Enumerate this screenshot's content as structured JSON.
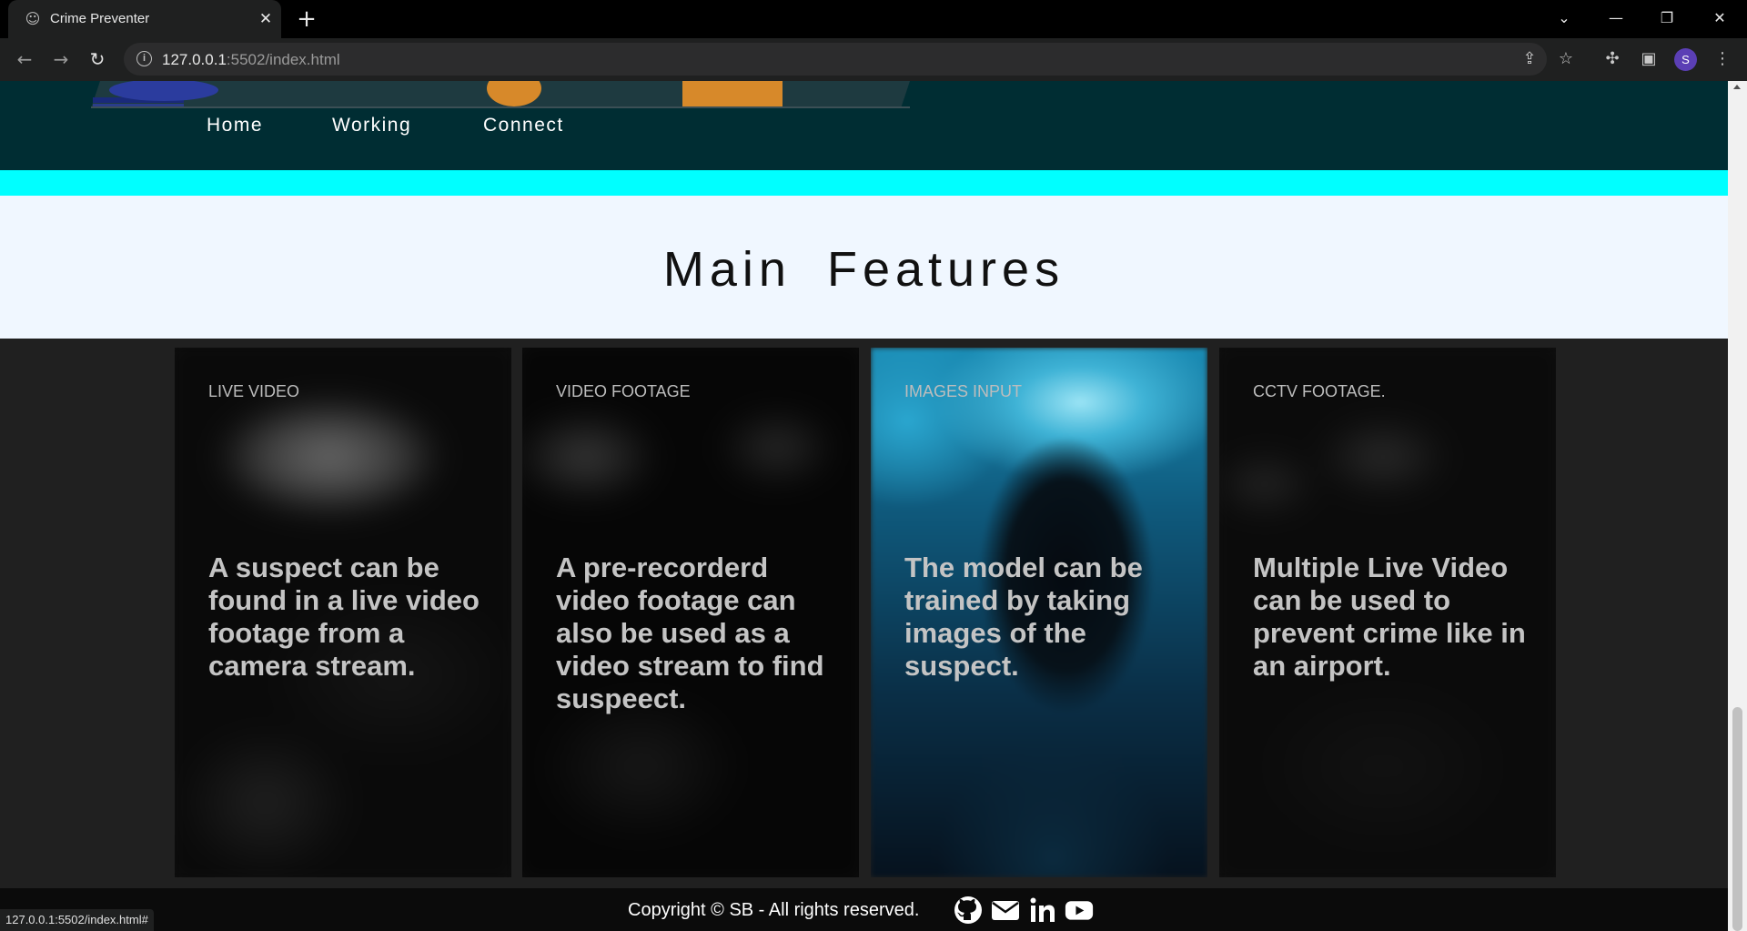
{
  "browser": {
    "tab_title": "Crime Preventer",
    "url_host": "127.0.0.1",
    "url_rest": ":5502/index.html",
    "profile_initial": "S",
    "status_url": "127.0.0.1:5502/index.html#"
  },
  "nav": {
    "links": [
      "Home",
      "Working",
      "Connect"
    ]
  },
  "features": {
    "title": "Main Features",
    "cards": [
      {
        "label": "LIVE VIDEO",
        "text": "A suspect can be found in a live video footage from a camera stream."
      },
      {
        "label": "VIDEO FOOTAGE",
        "text": "A pre-recorderd video footage can also be used as a video stream to find suspeect."
      },
      {
        "label": "IMAGES INPUT",
        "text": "The model can be trained by taking images of the suspect."
      },
      {
        "label": "CCTV FOOTAGE.",
        "text": "Multiple Live Video can be used to prevent crime like in an airport."
      }
    ]
  },
  "footer": {
    "copyright": "Copyright © SB - All rights reserved.",
    "social_icons": [
      "github-icon",
      "mail-icon",
      "linkedin-icon",
      "youtube-icon"
    ]
  },
  "colors": {
    "nav_bg": "#002d33",
    "accent_bar": "#00ffff",
    "section_head_bg": "#f0f7ff",
    "features_bg": "#202020"
  }
}
